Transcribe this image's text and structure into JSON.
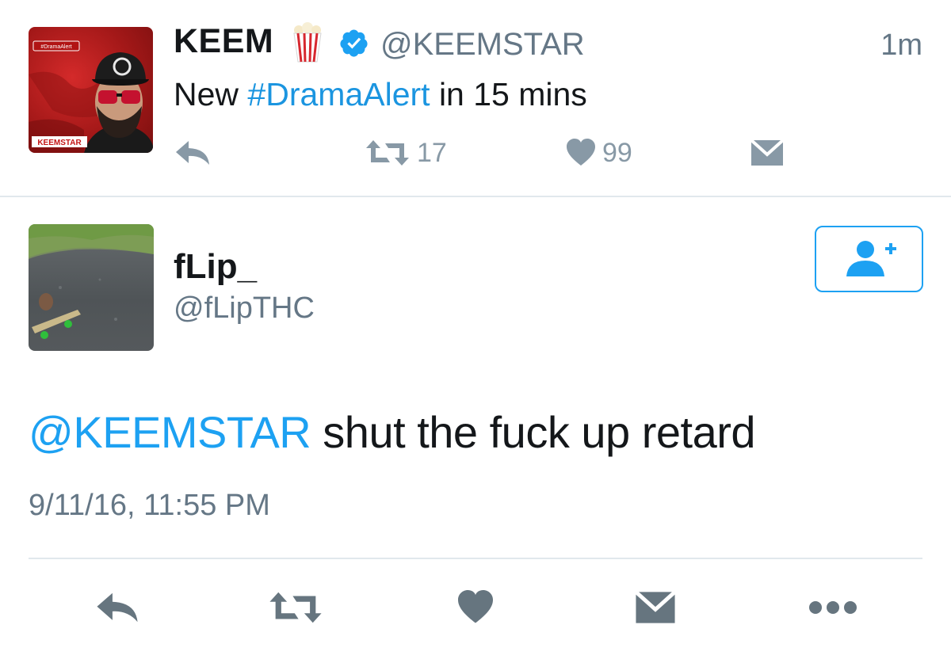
{
  "parent_tweet": {
    "name": "KEEM",
    "handle": "@KEEMSTAR",
    "time": "1m",
    "text_before": "New ",
    "hashtag": "#DramaAlert",
    "text_after": " in 15 mins",
    "retweet_count": "17",
    "like_count": "99",
    "avatar_icon": "keemstar-avatar",
    "avatar_badge_top": "#DramaAlert",
    "avatar_badge_bottom": "KEEMSTAR",
    "emoji_icon": "popcorn-icon",
    "verified_icon": "verified-badge-icon"
  },
  "main_tweet": {
    "name": "fLip_",
    "handle": "@fLipTHC",
    "mention": "@KEEMSTAR",
    "text": " shut the fuck up retard",
    "timestamp": "9/11/16, 11:55 PM",
    "avatar_icon": "skateboard-photo-avatar"
  },
  "actions": [
    "reply-icon",
    "retweet-icon",
    "like-icon",
    "direct-message-icon",
    "more-icon"
  ],
  "colors": {
    "link": "#1da1f2",
    "hashtag": "#1b95e0",
    "icon_gray": "#8899a6",
    "action_gray": "#66757f",
    "text": "#14171a",
    "secondary_text": "#657786"
  }
}
